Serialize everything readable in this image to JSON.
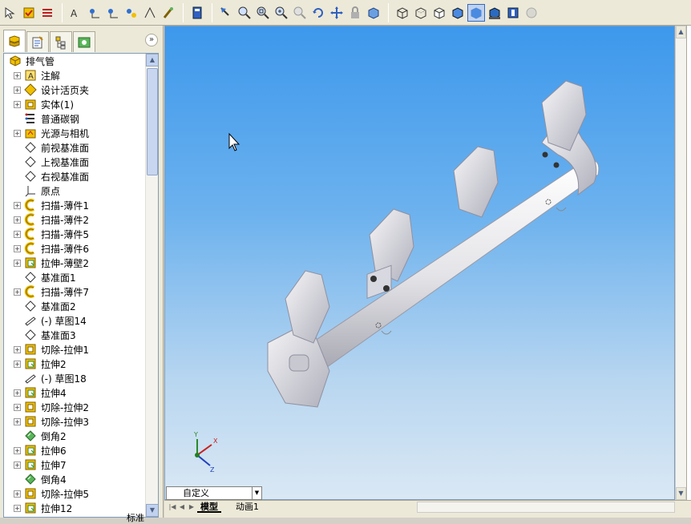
{
  "toolbar": {
    "groups": [
      [
        "select-icon",
        "check-box-icon",
        "options-icon"
      ],
      [
        "spell-icon",
        "pin-icon",
        "measure-icon",
        "mass-icon",
        "sensor-icon",
        "brush-icon"
      ],
      [
        "calculator-icon"
      ],
      [
        "pointer-icon",
        "zoom-fit-icon",
        "zoom-area-icon",
        "zoom-inout-icon",
        "zoom-selection-icon",
        "rotate-icon",
        "pan-icon",
        "lock-icon",
        "view-orient-icon"
      ],
      [
        "wireframe-icon",
        "hidden-lines-visible-icon",
        "hidden-lines-removed-icon",
        "shaded-edges-icon",
        "shaded-icon",
        "shadows-icon",
        "section-view-icon",
        "realview-icon"
      ]
    ]
  },
  "panel": {
    "tabs": [
      "feature-manager-icon",
      "property-manager-icon",
      "configuration-manager-icon",
      "appearance-icon"
    ],
    "collapse_label": "»"
  },
  "tree": [
    {
      "label": "排气管",
      "icon": "part-icon",
      "expandable": false,
      "root": true
    },
    {
      "label": "注解",
      "icon": "annotation-icon",
      "expandable": true
    },
    {
      "label": "设计活页夹",
      "icon": "design-binder-icon",
      "expandable": true
    },
    {
      "label": "实体(1)",
      "icon": "solid-bodies-icon",
      "expandable": true
    },
    {
      "label": "普通碳钢",
      "icon": "material-icon",
      "expandable": false
    },
    {
      "label": "光源与相机",
      "icon": "lights-icon",
      "expandable": true
    },
    {
      "label": "前视基准面",
      "icon": "plane-icon",
      "expandable": false
    },
    {
      "label": "上视基准面",
      "icon": "plane-icon",
      "expandable": false
    },
    {
      "label": "右视基准面",
      "icon": "plane-icon",
      "expandable": false
    },
    {
      "label": "原点",
      "icon": "origin-icon",
      "expandable": false
    },
    {
      "label": "扫描-薄件1",
      "icon": "sweep-icon",
      "expandable": true
    },
    {
      "label": "扫描-薄件2",
      "icon": "sweep-icon",
      "expandable": true
    },
    {
      "label": "扫描-薄件5",
      "icon": "sweep-icon",
      "expandable": true
    },
    {
      "label": "扫描-薄件6",
      "icon": "sweep-icon",
      "expandable": true
    },
    {
      "label": "拉伸-薄壁2",
      "icon": "extrude-icon",
      "expandable": true
    },
    {
      "label": "基准面1",
      "icon": "plane-icon",
      "expandable": false
    },
    {
      "label": "扫描-薄件7",
      "icon": "sweep-icon",
      "expandable": true
    },
    {
      "label": "基准面2",
      "icon": "plane-icon",
      "expandable": false
    },
    {
      "label": "(-) 草图14",
      "icon": "sketch-icon",
      "expandable": false
    },
    {
      "label": "基准面3",
      "icon": "plane-icon",
      "expandable": false
    },
    {
      "label": "切除-拉伸1",
      "icon": "cut-extrude-icon",
      "expandable": true
    },
    {
      "label": "拉伸2",
      "icon": "extrude-icon",
      "expandable": true
    },
    {
      "label": "(-) 草图18",
      "icon": "sketch-icon",
      "expandable": false
    },
    {
      "label": "拉伸4",
      "icon": "extrude-icon",
      "expandable": true
    },
    {
      "label": "切除-拉伸2",
      "icon": "cut-extrude-icon",
      "expandable": true
    },
    {
      "label": "切除-拉伸3",
      "icon": "cut-extrude-icon",
      "expandable": true
    },
    {
      "label": "倒角2",
      "icon": "chamfer-icon",
      "expandable": false
    },
    {
      "label": "拉伸6",
      "icon": "extrude-icon",
      "expandable": true
    },
    {
      "label": "拉伸7",
      "icon": "extrude-icon",
      "expandable": true
    },
    {
      "label": "倒角4",
      "icon": "chamfer-icon",
      "expandable": false
    },
    {
      "label": "切除-拉伸5",
      "icon": "cut-extrude-icon",
      "expandable": true
    },
    {
      "label": "拉伸12",
      "icon": "extrude-icon",
      "expandable": true
    }
  ],
  "viewport": {
    "axes": {
      "x": "X",
      "y": "Y",
      "z": "Z"
    }
  },
  "bottom": {
    "config_value": "自定义",
    "tabs": [
      "模型",
      "动画1"
    ],
    "taskbar_text": "标准"
  }
}
